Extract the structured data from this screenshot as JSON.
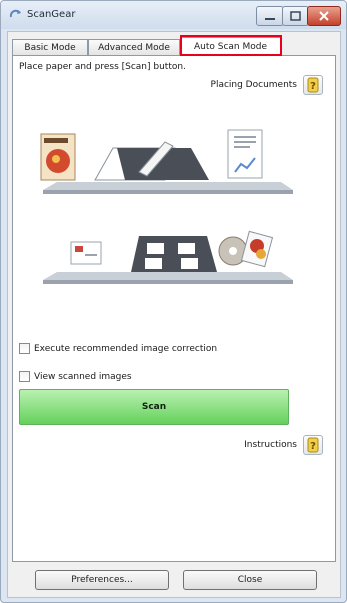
{
  "window": {
    "title": "ScanGear"
  },
  "tabs": [
    {
      "label": "Basic Mode"
    },
    {
      "label": "Advanced Mode"
    },
    {
      "label": "Auto Scan Mode",
      "selected": true
    }
  ],
  "main": {
    "instruction": "Place paper and press [Scan] button.",
    "placing_documents_label": "Placing Documents",
    "checkboxes": [
      {
        "label": "Execute recommended image correction",
        "checked": false
      },
      {
        "label": "View scanned images",
        "checked": false
      }
    ],
    "scan_label": "Scan",
    "instructions_label": "Instructions"
  },
  "footer": {
    "preferences_label": "Preferences...",
    "close_label": "Close"
  },
  "colors": {
    "scan_button": "#64d15c",
    "tab_highlight": "#e8001c"
  }
}
